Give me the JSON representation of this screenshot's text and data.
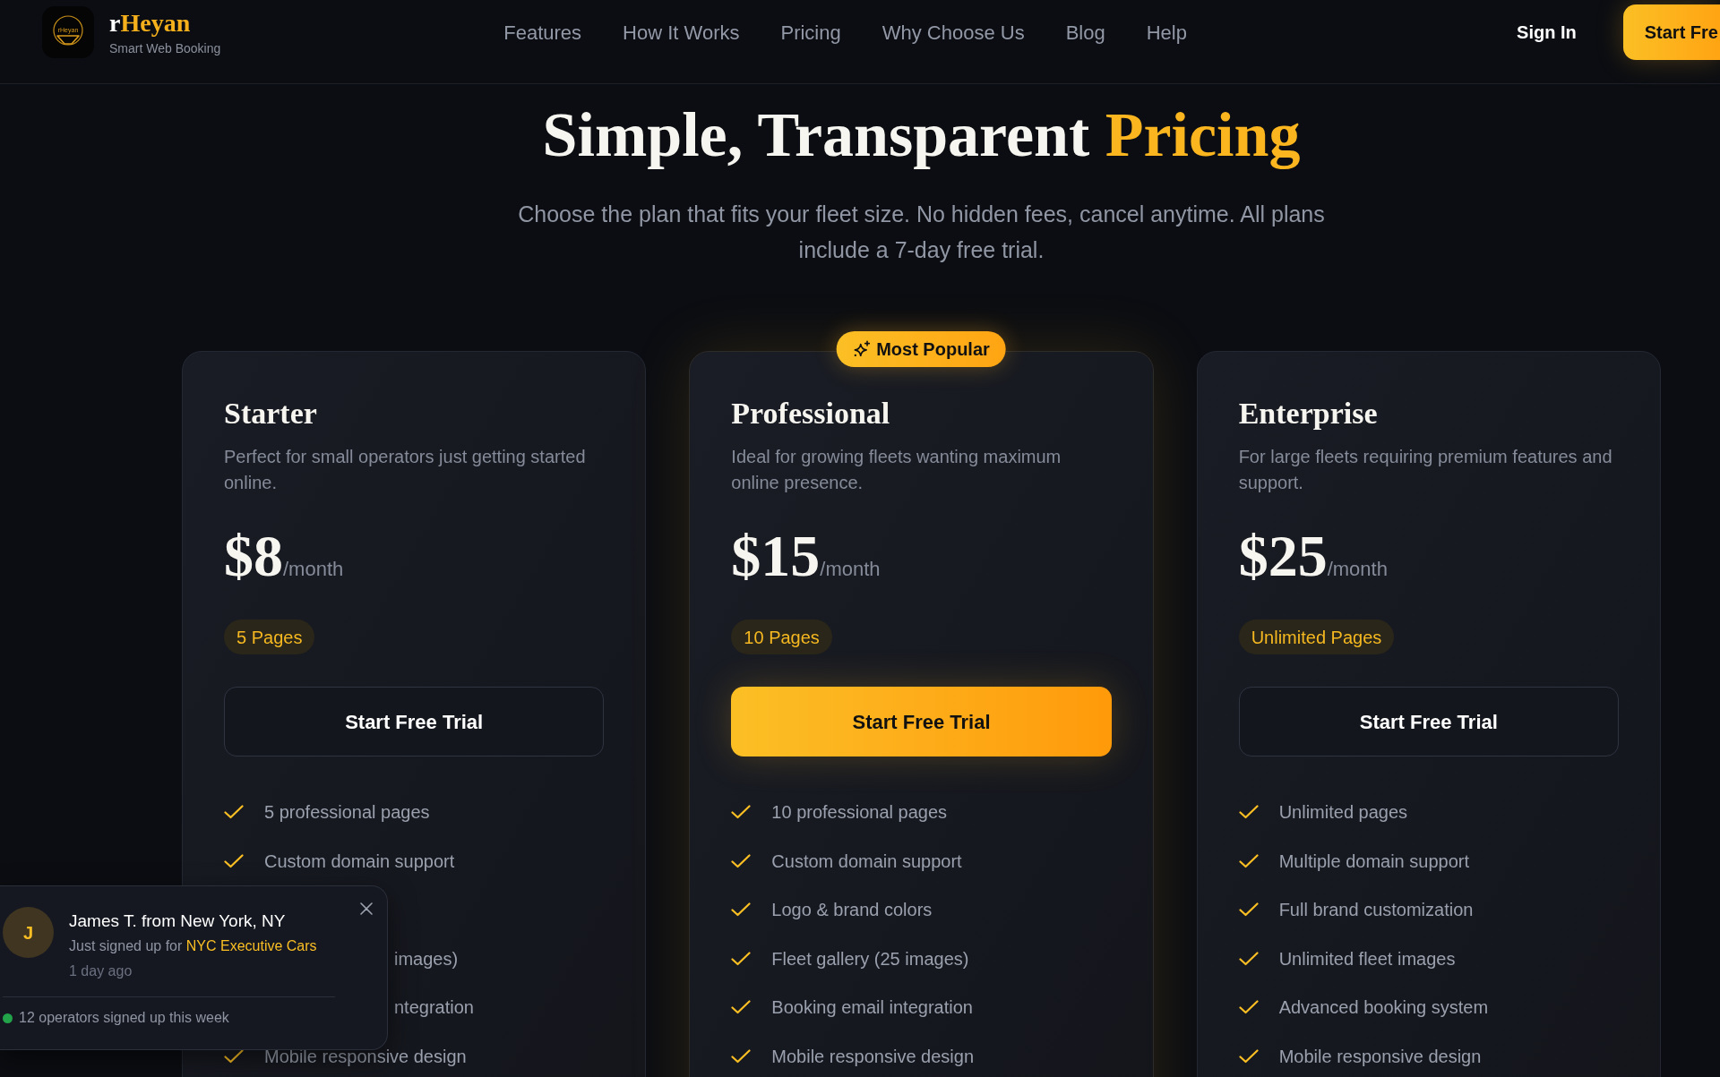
{
  "header": {
    "logo": {
      "mark_text": "rHeyan"
    },
    "brand": {
      "name_lead": "r",
      "name_accent": "Heyan",
      "tagline": "Smart Web Booking"
    },
    "nav": [
      "Features",
      "How It Works",
      "Pricing",
      "Why Choose Us",
      "Blog",
      "Help"
    ],
    "sign_in": "Sign In",
    "cta": "Start Fre"
  },
  "hero": {
    "title_lead": "Simple, Transparent",
    "title_accent": "Pricing",
    "subtitle": "Choose the plan that fits your fleet size. No hidden fees, cancel anytime. All plans include a 7-day free trial."
  },
  "plans": [
    {
      "name": "Starter",
      "description": "Perfect for small operators just getting started online.",
      "price": "$8",
      "period": "/month",
      "pages": "5 Pages",
      "button": "Start Free Trial",
      "featured": false,
      "features": [
        {
          "kind": "check",
          "text": "5 professional pages"
        },
        {
          "kind": "check",
          "text": "Custom domain support"
        },
        {
          "kind": "covered"
        },
        {
          "kind": "fragment",
          "text": "images)"
        },
        {
          "kind": "fragment",
          "text": "ntegration"
        },
        {
          "kind": "check",
          "text": "Mobile responsive design"
        }
      ]
    },
    {
      "name": "Professional",
      "badge": "Most Popular",
      "description": "Ideal for growing fleets wanting maximum online presence.",
      "price": "$15",
      "period": "/month",
      "pages": "10 Pages",
      "button": "Start Free Trial",
      "featured": true,
      "features": [
        {
          "kind": "check",
          "text": "10 professional pages"
        },
        {
          "kind": "check",
          "text": "Custom domain support"
        },
        {
          "kind": "check",
          "text": "Logo & brand colors"
        },
        {
          "kind": "check",
          "text": "Fleet gallery (25 images)"
        },
        {
          "kind": "check",
          "text": "Booking email integration"
        },
        {
          "kind": "check",
          "text": "Mobile responsive design"
        }
      ]
    },
    {
      "name": "Enterprise",
      "description": "For large fleets requiring premium features and support.",
      "price": "$25",
      "period": "/month",
      "pages": "Unlimited Pages",
      "button": "Start Free Trial",
      "featured": false,
      "features": [
        {
          "kind": "check",
          "text": "Unlimited pages"
        },
        {
          "kind": "check",
          "text": "Multiple domain support"
        },
        {
          "kind": "check",
          "text": "Full brand customization"
        },
        {
          "kind": "check",
          "text": "Unlimited fleet images"
        },
        {
          "kind": "check",
          "text": "Advanced booking system"
        },
        {
          "kind": "check",
          "text": "Mobile responsive design"
        }
      ]
    }
  ],
  "toast": {
    "initial": "J",
    "title": "James T. from New York, NY",
    "message": "Just signed up for",
    "highlight": "NYC Executive Cars",
    "time": "1 day ago",
    "footer": "12 operators signed up this week"
  }
}
